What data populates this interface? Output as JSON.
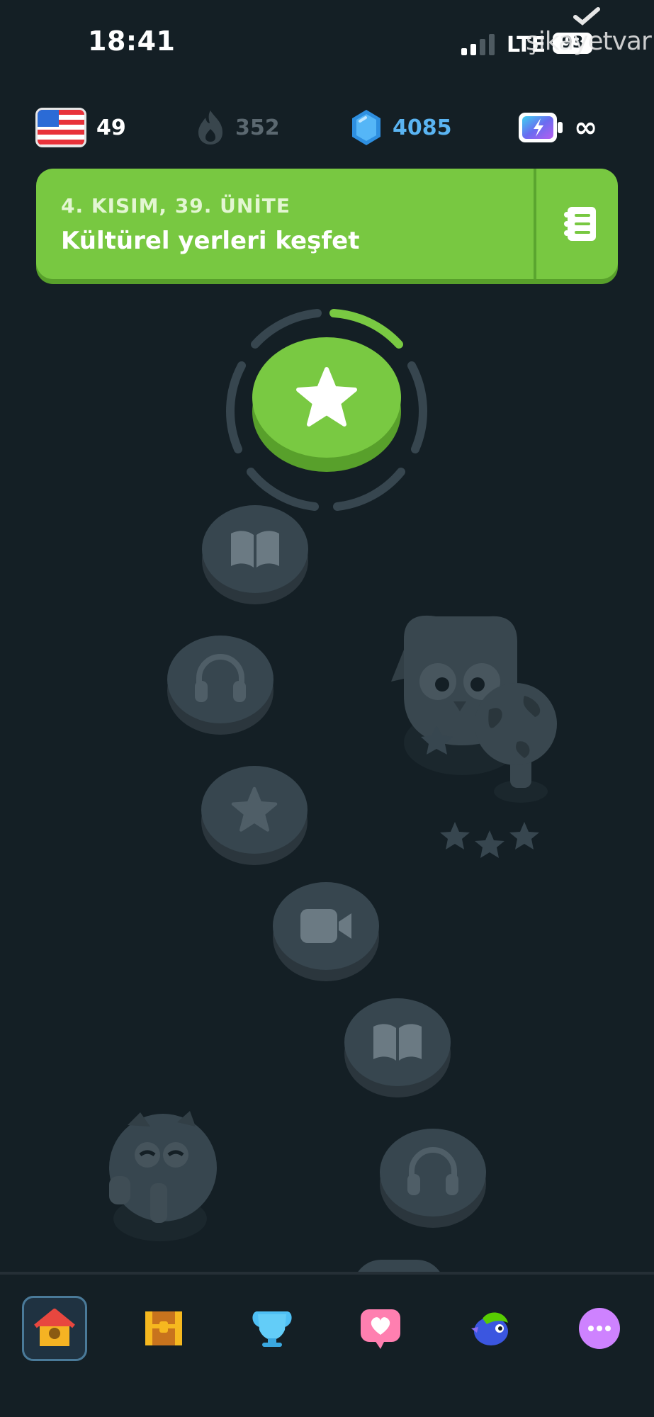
{
  "status_bar": {
    "time": "18:41",
    "network": "LTE",
    "battery": "93",
    "watermark": "şikayetvar"
  },
  "stats": {
    "language_flag": "us-flag",
    "language_level": "49",
    "streak": "352",
    "gems": "4085",
    "energy": "∞"
  },
  "unit": {
    "section_label": "4. KISIM, 39. ÜNİTE",
    "title": "Kültürel yerleri keşfet"
  },
  "path_nodes": [
    {
      "type": "star",
      "state": "active",
      "progress": 0.17
    },
    {
      "type": "book-icon",
      "state": "locked"
    },
    {
      "type": "headphones-icon",
      "state": "locked"
    },
    {
      "type": "star-icon",
      "state": "locked"
    },
    {
      "type": "video-camera-icon",
      "state": "locked"
    },
    {
      "type": "book-icon",
      "state": "locked"
    },
    {
      "type": "headphones-icon",
      "state": "locked"
    }
  ],
  "bottom_nav": [
    {
      "name": "home",
      "icon": "home-icon",
      "active": true
    },
    {
      "name": "quests",
      "icon": "treasure-chest-icon",
      "active": false
    },
    {
      "name": "leaderboard",
      "icon": "trophy-icon",
      "active": false
    },
    {
      "name": "practice",
      "icon": "heart-chat-icon",
      "active": false
    },
    {
      "name": "profile",
      "icon": "bird-icon",
      "active": false
    },
    {
      "name": "more",
      "icon": "more-icon",
      "active": false
    }
  ],
  "colors": {
    "background": "#141f25",
    "accent_green": "#79c942",
    "gem_blue": "#4fb3f5",
    "locked_node": "#37464f",
    "streak_gray": "#5b6870"
  }
}
